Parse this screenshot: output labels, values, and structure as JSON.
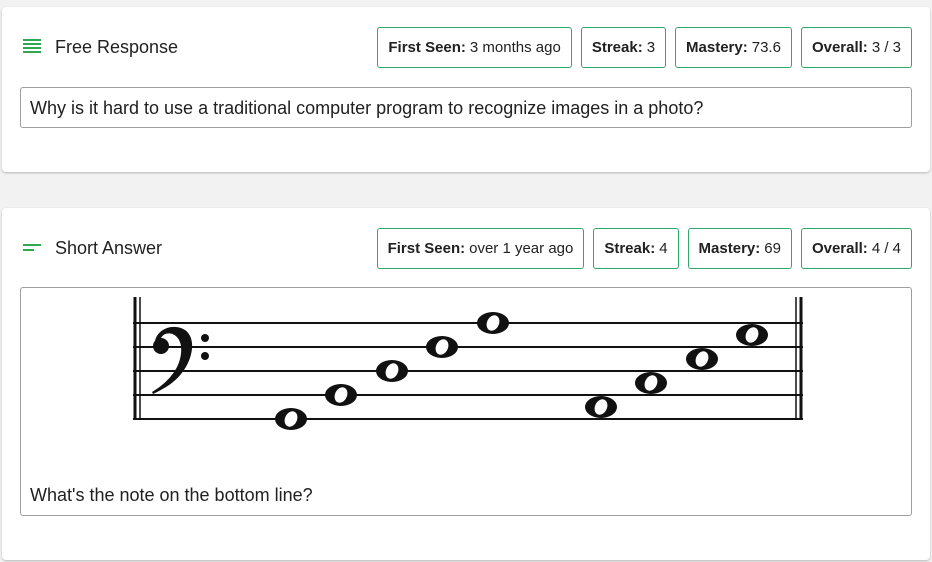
{
  "cards": [
    {
      "type_icon": "lines-icon",
      "type_label": "Free Response",
      "stats": [
        {
          "key": "First Seen:",
          "value": "3 months ago"
        },
        {
          "key": "Streak:",
          "value": "3"
        },
        {
          "key": "Mastery:",
          "value": "73.6"
        },
        {
          "key": "Overall:",
          "value": "3 / 3"
        }
      ],
      "question": "Why is it hard to use a traditional computer program to recognize images in a photo?"
    },
    {
      "type_icon": "short-lines-icon",
      "type_label": "Short Answer",
      "stats": [
        {
          "key": "First Seen:",
          "value": "over 1 year ago"
        },
        {
          "key": "Streak:",
          "value": "4"
        },
        {
          "key": "Mastery:",
          "value": "69"
        },
        {
          "key": "Overall:",
          "value": "4 / 4"
        }
      ],
      "question": "What's the note on the bottom line?",
      "image": "bass-clef-staff-with-notes"
    }
  ],
  "colors": {
    "accent": "#2fa84f",
    "border": "#9e9e9e",
    "background": "#f2f2f2"
  }
}
